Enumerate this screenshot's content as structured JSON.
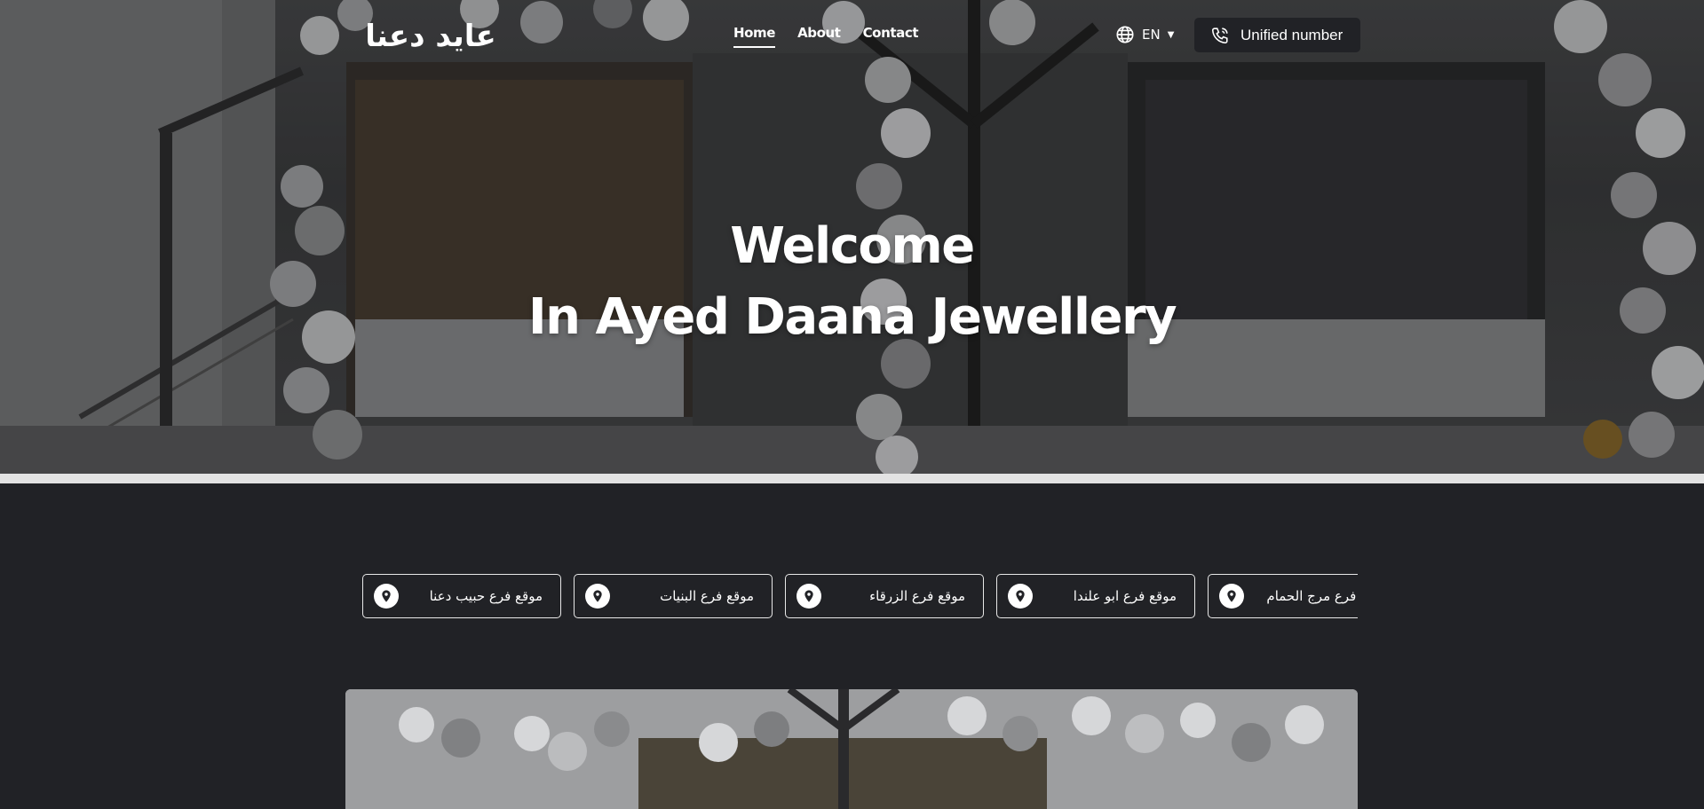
{
  "brand": {
    "logo_text": "عايد دعنا"
  },
  "nav": {
    "items": [
      {
        "label": "Home",
        "active": true
      },
      {
        "label": "About",
        "active": false
      },
      {
        "label": "Contact",
        "active": false
      }
    ]
  },
  "language": {
    "current": "EN",
    "icon": "globe-icon"
  },
  "unified": {
    "label": "Unified number",
    "icon": "phone-icon"
  },
  "hero": {
    "line1": "Welcome",
    "line2": "In Ayed Daana Jewellery"
  },
  "branches": [
    {
      "label": "موقع فرع حبيب دعنا"
    },
    {
      "label": "موقع فرع البنيات"
    },
    {
      "label": "موقع فرع الزرقاء"
    },
    {
      "label": "موقع فرع ابو علندا"
    },
    {
      "label": "موقع فرع مرج الحمام"
    }
  ],
  "colors": {
    "page_bg": "#212226",
    "button_bg": "#212226",
    "text": "#ffffff"
  }
}
